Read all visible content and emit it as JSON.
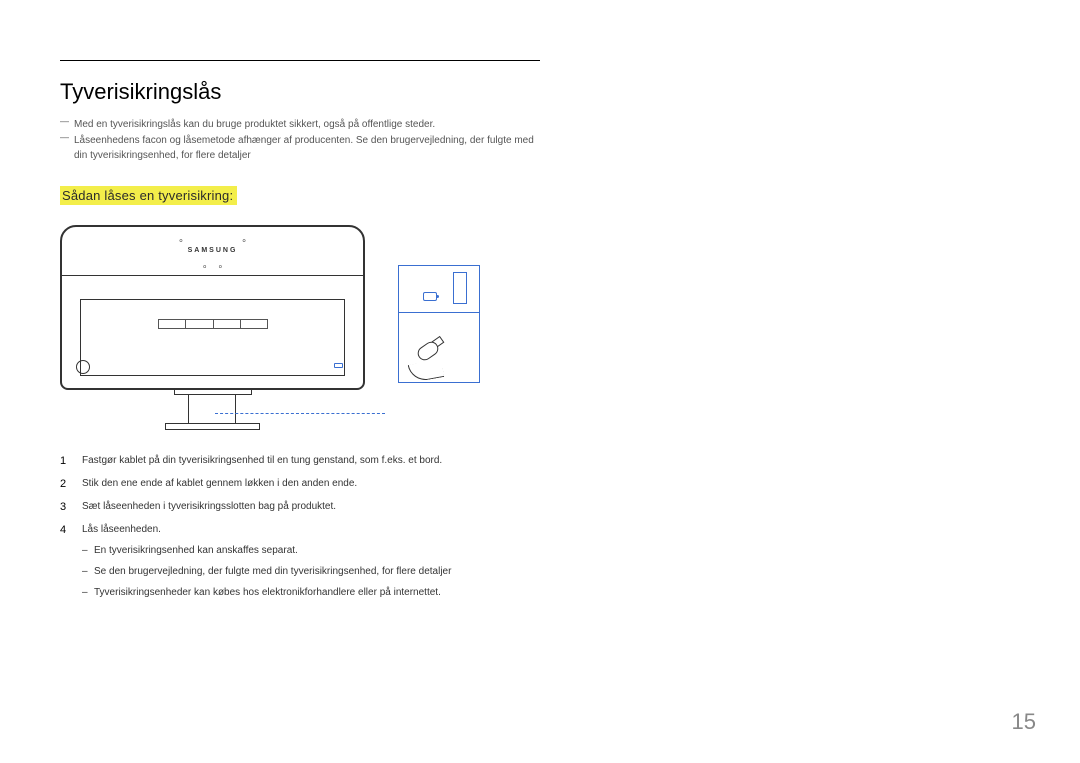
{
  "title": "Tyverisikringslås",
  "notes": [
    "Med en tyverisikringslås kan du bruge produktet sikkert, også på offentlige steder.",
    "Låseenhedens facon og låsemetode afhænger af producenten. Se den brugervejledning, der fulgte med din tyverisikringsenhed, for flere detaljer"
  ],
  "subheading": "Sådan låses en tyverisikring:",
  "figure": {
    "brand": "SAMSUNG"
  },
  "steps": [
    {
      "text": "Fastgør kablet på din tyverisikringsenhed til en tung genstand, som f.eks. et bord."
    },
    {
      "text": "Stik den ene ende af kablet gennem løkken i den anden ende."
    },
    {
      "text": "Sæt låseenheden i tyverisikringsslotten bag på produktet."
    },
    {
      "text": "Lås låseenheden.",
      "sub": [
        "En tyverisikringsenhed kan anskaffes separat.",
        "Se den brugervejledning, der fulgte med din tyverisikringsenhed, for flere detaljer",
        "Tyverisikringsenheder kan købes hos elektronikforhandlere eller på internettet."
      ]
    }
  ],
  "page_number": "15"
}
